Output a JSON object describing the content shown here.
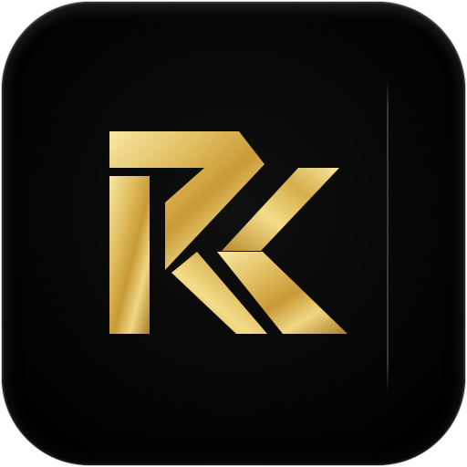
{
  "app_icon": {
    "logo_monogram": "RK",
    "colors": {
      "background": "#000000",
      "gold_light": "#f6e39a",
      "gold_mid": "#d8b24f",
      "gold_dark": "#9a7320"
    }
  }
}
